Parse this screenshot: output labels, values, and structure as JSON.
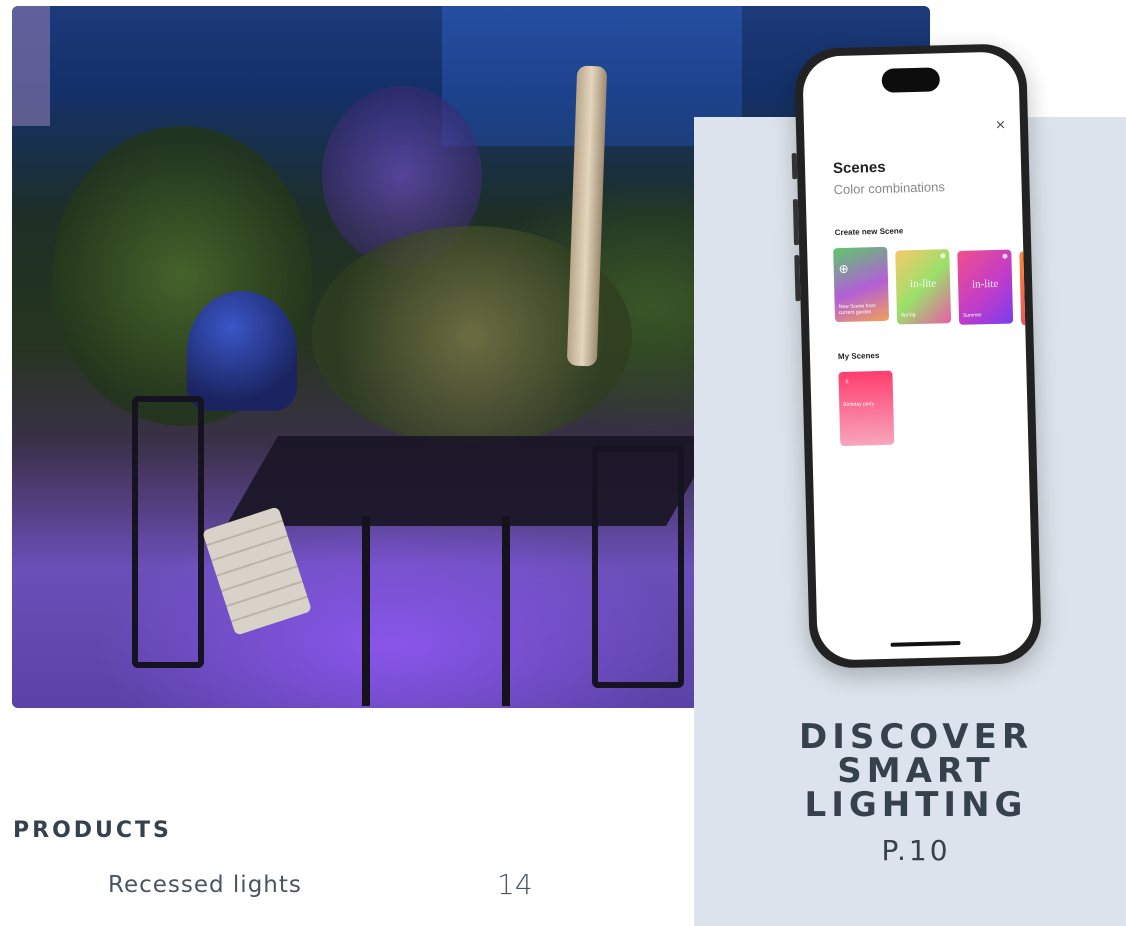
{
  "feature": {
    "title_lines": [
      "DISCOVER",
      "SMART",
      "LIGHTING"
    ],
    "page_ref": "P.10"
  },
  "toc": {
    "heading": "PRODUCTS",
    "items": [
      {
        "label": "Recessed lights",
        "page": "14"
      }
    ]
  },
  "phone_app": {
    "close_symbol": "×",
    "title": "Scenes",
    "subtitle": "Color combinations",
    "create_heading": "Create new Scene",
    "create_cards": [
      {
        "caption": "New Scene from current garden",
        "brand": "",
        "colors": [
          "#5ec86a",
          "#b25fd8",
          "#f2a05a"
        ]
      },
      {
        "caption": "Spring",
        "brand": "in-lite",
        "colors": [
          "#f7c96a",
          "#9be06a",
          "#e85ca8"
        ]
      },
      {
        "caption": "Summer",
        "brand": "in-lite",
        "colors": [
          "#f0508c",
          "#c23cc8",
          "#7a3cf0"
        ]
      }
    ],
    "my_heading": "My Scenes",
    "my_cards": [
      {
        "caption": "Birthday party",
        "colors": [
          "#ff3d6e",
          "#f7a6bd"
        ]
      }
    ]
  }
}
